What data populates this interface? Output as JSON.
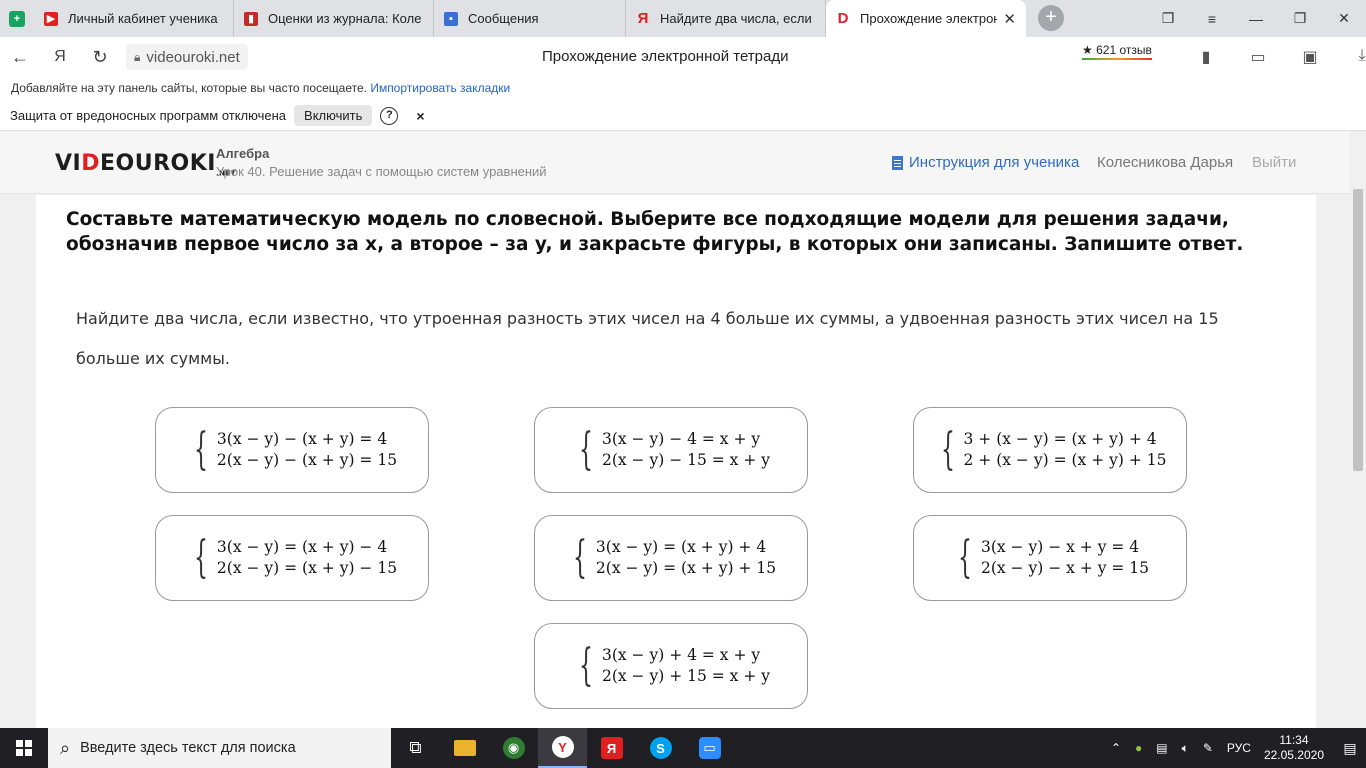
{
  "browser": {
    "tabs": [
      {
        "label": "Личный кабинет ученика",
        "icon": "youtube-icon"
      },
      {
        "label": "Оценки из журнала: Коле",
        "icon": "book-icon"
      },
      {
        "label": "Сообщения",
        "icon": "chat-icon"
      },
      {
        "label": "Найдите два числа, если и",
        "icon": "yandex-icon"
      },
      {
        "label": "Прохождение электрон",
        "icon": "videouroki-icon",
        "active": true
      }
    ],
    "url": "videouroki.net",
    "page_title": "Прохождение электронной тетради",
    "reviews": "★ 621 отзыв",
    "bookmarks_hint": "Добавляйте на эту панель сайты, которые вы часто посещаете.",
    "bookmarks_import": "Импортировать закладки",
    "protection_text": "Защита от вредоносных программ отключена",
    "protection_button": "Включить",
    "protection_help": "?",
    "protection_close": "×"
  },
  "site": {
    "logo_left": "VI",
    "logo_red": "D",
    "logo_right": "EOUROKI",
    "logo_suffix": ".NET",
    "subject": "Алгебра",
    "lesson": "Урок 40. Решение задач с помощью систем уравнений",
    "instructions_link": "Инструкция для ученика",
    "user_name": "Колесникова Дарья",
    "logout": "Выйти"
  },
  "task": {
    "heading": "Составьте математическую модель по словесной. Выберите все подходящие модели для решения задачи, обозначив первое число за x, а второе – за y, и закрасьте фигуры, в которых они записаны. Запишите ответ.",
    "problem": "Найдите два числа, если известно, что утроенная разность этих чисел на 4 больше их суммы, а удвоенная разность этих чисел на 15 больше их суммы.",
    "options": [
      {
        "eq1": "3(x − y) − (x + y) = 4",
        "eq2": "2(x − y) − (x + y) = 15"
      },
      {
        "eq1": "3(x − y) − 4 = x + y",
        "eq2": "2(x − y) − 15 = x + y"
      },
      {
        "eq1": "3 + (x − y) = (x + y) + 4",
        "eq2": "2 + (x − y) = (x + y) + 15"
      },
      {
        "eq1": "3(x − y) = (x + y) − 4",
        "eq2": "2(x − y) = (x + y) − 15"
      },
      {
        "eq1": "3(x − y) = (x + y) + 4",
        "eq2": "2(x − y) = (x + y) + 15"
      },
      {
        "eq1": "3(x − y) − x + y = 4",
        "eq2": "2(x − y) − x + y = 15"
      },
      {
        "eq1": "3(x − y) + 4 = x + y",
        "eq2": "2(x − y) + 15 = x + y"
      }
    ]
  },
  "taskbar": {
    "search_placeholder": "Введите здесь текст для поиска",
    "language": "РУС",
    "time": "11:34",
    "date": "22.05.2020"
  }
}
